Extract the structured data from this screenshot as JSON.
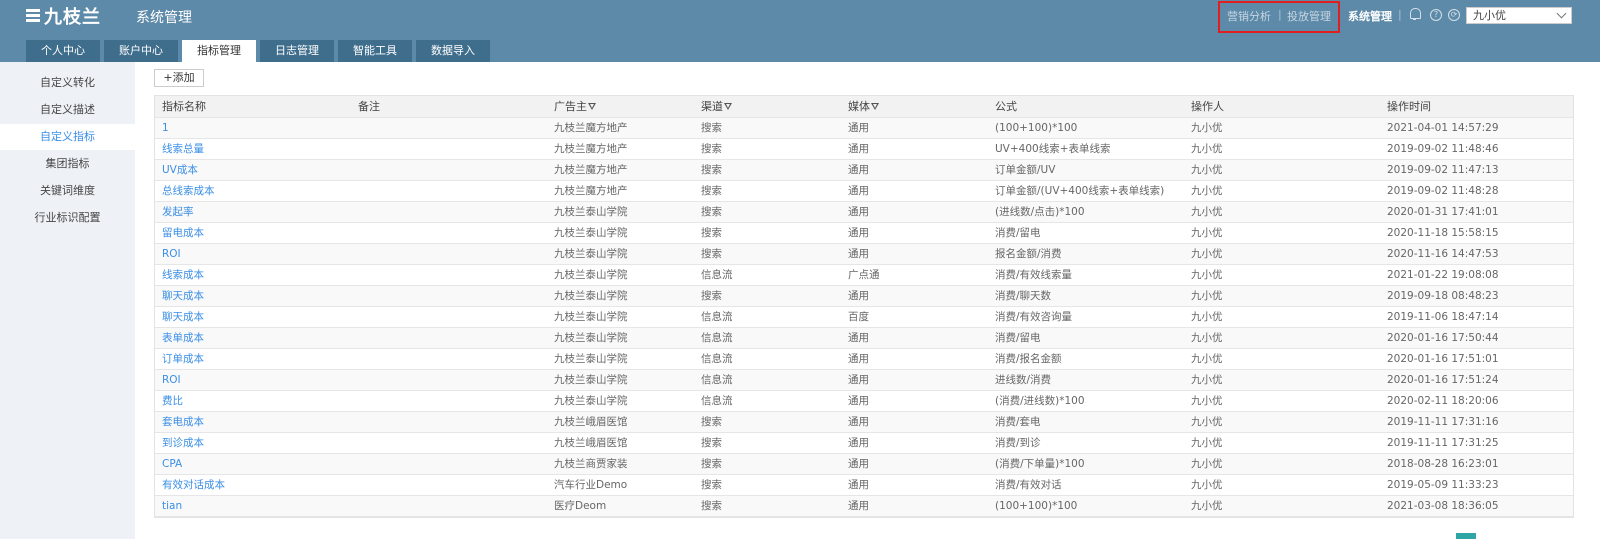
{
  "header": {
    "logo_text": "九枝兰",
    "title": "系统管理",
    "links": [
      "营销分析",
      "投放管理"
    ],
    "separator": "|",
    "active_section": "系统管理",
    "user": "九小优",
    "colors": {
      "header_bg": "#5d8aa8",
      "tab_bg": "#3f6d8c",
      "link": "#3a8ee6",
      "highlight": "#e02020"
    }
  },
  "tabs": [
    {
      "label": "个人中心"
    },
    {
      "label": "账户中心"
    },
    {
      "label": "指标管理",
      "active": true
    },
    {
      "label": "日志管理"
    },
    {
      "label": "智能工具"
    },
    {
      "label": "数据导入"
    }
  ],
  "sidebar": {
    "items": [
      {
        "label": "自定义转化"
      },
      {
        "label": "自定义描述"
      },
      {
        "label": "自定义指标",
        "active": true
      },
      {
        "label": "集团指标"
      },
      {
        "label": "关键词维度"
      },
      {
        "label": "行业标识配置"
      }
    ]
  },
  "toolbar": {
    "add_label": "+添加"
  },
  "table": {
    "columns": [
      "指标名称",
      "备注",
      "广告主",
      "渠道",
      "媒体",
      "公式",
      "操作人",
      "操作时间"
    ],
    "rows": [
      [
        "1",
        "",
        "九枝兰魔方地产",
        "搜索",
        "通用",
        "(100+100)*100",
        "九小优",
        "2021-04-01 14:57:29"
      ],
      [
        "线索总量",
        "",
        "九枝兰魔方地产",
        "搜索",
        "通用",
        "UV+400线索+表单线索",
        "九小优",
        "2019-09-02 11:48:46"
      ],
      [
        "UV成本",
        "",
        "九枝兰魔方地产",
        "搜索",
        "通用",
        "订单金额/UV",
        "九小优",
        "2019-09-02 11:47:13"
      ],
      [
        "总线索成本",
        "",
        "九枝兰魔方地产",
        "搜索",
        "通用",
        "订单金额/(UV+400线索+表单线索)",
        "九小优",
        "2019-09-02 11:48:28"
      ],
      [
        "发起率",
        "",
        "九枝兰泰山学院",
        "搜索",
        "通用",
        "(进线数/点击)*100",
        "九小优",
        "2020-01-31 17:41:01"
      ],
      [
        "留电成本",
        "",
        "九枝兰泰山学院",
        "搜索",
        "通用",
        "消费/留电",
        "九小优",
        "2020-11-18 15:58:15"
      ],
      [
        "ROI",
        "",
        "九枝兰泰山学院",
        "搜索",
        "通用",
        "报名金额/消费",
        "九小优",
        "2020-11-16 14:47:53"
      ],
      [
        "线索成本",
        "",
        "九枝兰泰山学院",
        "信息流",
        "广点通",
        "消费/有效线索量",
        "九小优",
        "2021-01-22 19:08:08"
      ],
      [
        "聊天成本",
        "",
        "九枝兰泰山学院",
        "搜索",
        "通用",
        "消费/聊天数",
        "九小优",
        "2019-09-18 08:48:23"
      ],
      [
        "聊天成本",
        "",
        "九枝兰泰山学院",
        "信息流",
        "百度",
        "消费/有效咨询量",
        "九小优",
        "2019-11-06 18:47:14"
      ],
      [
        "表单成本",
        "",
        "九枝兰泰山学院",
        "信息流",
        "通用",
        "消费/留电",
        "九小优",
        "2020-01-16 17:50:44"
      ],
      [
        "订单成本",
        "",
        "九枝兰泰山学院",
        "信息流",
        "通用",
        "消费/报名金额",
        "九小优",
        "2020-01-16 17:51:01"
      ],
      [
        "ROI",
        "",
        "九枝兰泰山学院",
        "信息流",
        "通用",
        "进线数/消费",
        "九小优",
        "2020-01-16 17:51:24"
      ],
      [
        "费比",
        "",
        "九枝兰泰山学院",
        "信息流",
        "通用",
        "(消费/进线数)*100",
        "九小优",
        "2020-02-11 18:20:06"
      ],
      [
        "套电成本",
        "",
        "九枝兰峨眉医馆",
        "搜索",
        "通用",
        "消费/套电",
        "九小优",
        "2019-11-11 17:31:16"
      ],
      [
        "到诊成本",
        "",
        "九枝兰峨眉医馆",
        "搜索",
        "通用",
        "消费/到诊",
        "九小优",
        "2019-11-11 17:31:25"
      ],
      [
        "CPA",
        "",
        "九枝兰商贾家装",
        "搜索",
        "通用",
        "(消费/下单量)*100",
        "九小优",
        "2018-08-28 16:23:01"
      ],
      [
        "有效对话成本",
        "",
        "汽车行业Demo",
        "搜索",
        "通用",
        "消费/有效对话",
        "九小优",
        "2019-05-09 11:33:23"
      ],
      [
        "tian",
        "",
        "医疗Deom",
        "搜索",
        "通用",
        "(100+100)*100",
        "九小优",
        "2021-03-08 18:36:05"
      ]
    ]
  }
}
